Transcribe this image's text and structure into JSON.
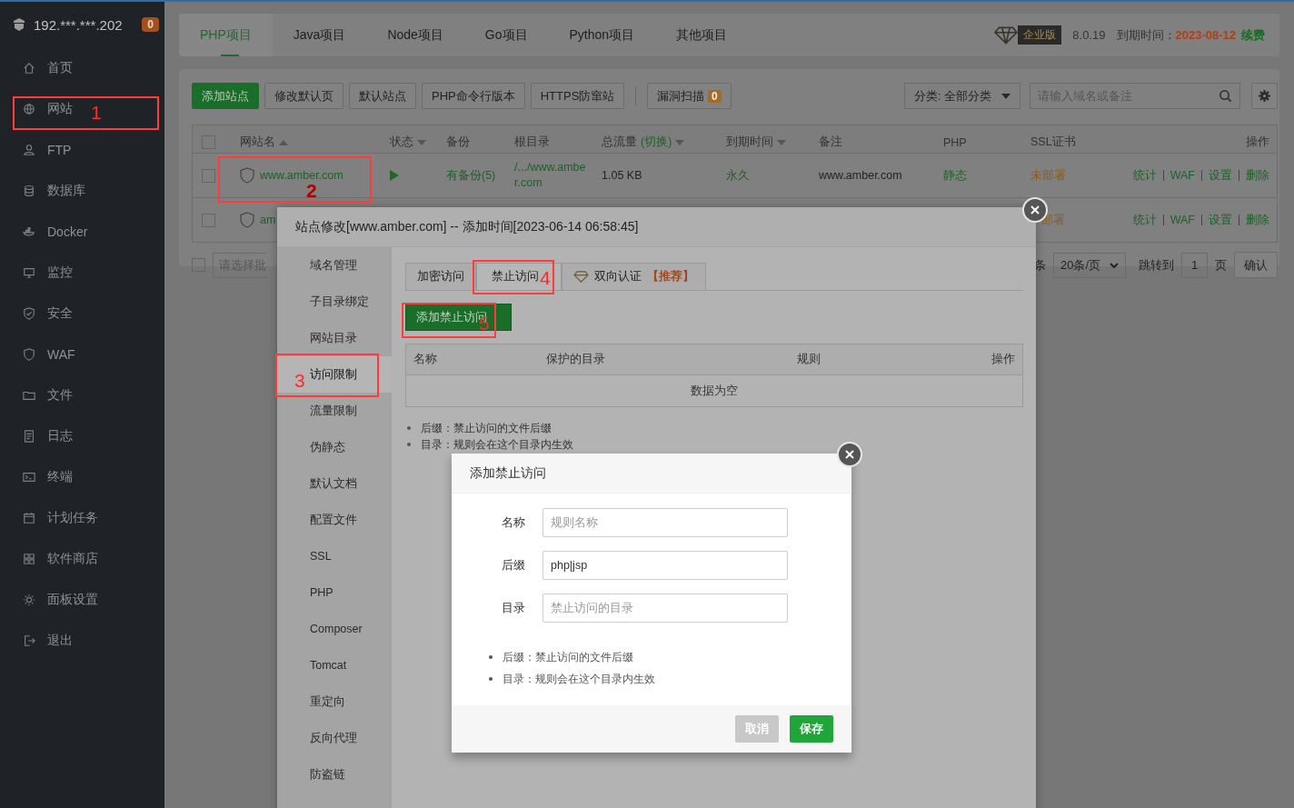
{
  "sidebar": {
    "host": "192.***.***.202",
    "badge": "0",
    "items": [
      {
        "label": "首页"
      },
      {
        "label": "网站"
      },
      {
        "label": "FTP"
      },
      {
        "label": "数据库"
      },
      {
        "label": "Docker"
      },
      {
        "label": "监控"
      },
      {
        "label": "安全"
      },
      {
        "label": "WAF"
      },
      {
        "label": "文件"
      },
      {
        "label": "日志"
      },
      {
        "label": "终端"
      },
      {
        "label": "计划任务"
      },
      {
        "label": "软件商店"
      },
      {
        "label": "面板设置"
      },
      {
        "label": "退出"
      }
    ]
  },
  "project_tabs": [
    {
      "label": "PHP项目",
      "selected": true
    },
    {
      "label": "Java项目",
      "selected": false
    },
    {
      "label": "Node项目",
      "selected": false
    },
    {
      "label": "Go项目",
      "selected": false
    },
    {
      "label": "Python项目",
      "selected": false
    },
    {
      "label": "其他项目",
      "selected": false
    }
  ],
  "edition": {
    "badge": "企业版",
    "version": "8.0.19",
    "expiry_label": "到期时间：",
    "expiry_date": "2023-08-12",
    "renew": "续费"
  },
  "toolbar": {
    "buttons": [
      {
        "label": "添加站点",
        "kind": "primary"
      },
      {
        "label": "修改默认页",
        "kind": "plain"
      },
      {
        "label": "默认站点",
        "kind": "plain"
      },
      {
        "label": "PHP命令行版本",
        "kind": "plain"
      },
      {
        "label": "HTTPS防窜站",
        "kind": "plain"
      }
    ],
    "scan": {
      "label": "漏洞扫描",
      "count": "0"
    },
    "category": "分类: 全部分类",
    "search_placeholder": "请输入域名或备注"
  },
  "table": {
    "header_checked": false,
    "columns": [
      {
        "label": "网站名",
        "kind": "sort-up"
      },
      {
        "label": "状态",
        "kind": "sort-down"
      },
      {
        "label": "备份"
      },
      {
        "label": "根目录"
      },
      {
        "label": "总流量",
        "extra": "(切换)",
        "kind": "sort-down"
      },
      {
        "label": "到期时间",
        "kind": "sort-down"
      },
      {
        "label": "备注"
      },
      {
        "label": "PHP"
      },
      {
        "label": "SSL证书"
      },
      {
        "label": "操作"
      }
    ],
    "rows": [
      {
        "checked": false,
        "name": "www.amber.com",
        "running": true,
        "backup": "有备份(5)",
        "root": "/.../www.amber.com",
        "traffic": "1.05 KB",
        "expiry": "永久",
        "remark": "www.amber.com",
        "php": "静态",
        "ssl": "未部署",
        "actions": [
          "统计",
          "WAF",
          "设置",
          "删除"
        ]
      },
      {
        "checked": false,
        "name": "am",
        "ssl": "部署",
        "actions": [
          "统计",
          "WAF",
          "设置",
          "删除"
        ]
      }
    ]
  },
  "footer": {
    "checked": false,
    "batch_placeholder": "请选择批",
    "count_fragment": "条",
    "page_size": "20条/页",
    "jump_label": "跳转到",
    "page": "1",
    "page_unit": "页",
    "confirm": "确认"
  },
  "site_dialog": {
    "title": "站点修改[www.amber.com] -- 添加时间[2023-06-14 06:58:45]",
    "nav": [
      {
        "label": "域名管理",
        "selected": false
      },
      {
        "label": "子目录绑定",
        "selected": false
      },
      {
        "label": "网站目录",
        "selected": false
      },
      {
        "label": "访问限制",
        "selected": true
      },
      {
        "label": "流量限制",
        "selected": false
      },
      {
        "label": "伪静态",
        "selected": false
      },
      {
        "label": "默认文档",
        "selected": false
      },
      {
        "label": "配置文件",
        "selected": false
      },
      {
        "label": "SSL",
        "selected": false
      },
      {
        "label": "PHP",
        "selected": false
      },
      {
        "label": "Composer",
        "selected": false
      },
      {
        "label": "Tomcat",
        "selected": false
      },
      {
        "label": "重定向",
        "selected": false
      },
      {
        "label": "反向代理",
        "selected": false
      },
      {
        "label": "防盗链",
        "selected": false
      }
    ],
    "tabs": [
      {
        "label": "加密访问",
        "selected": false
      },
      {
        "label": "禁止访问",
        "selected": true
      },
      {
        "label": "双向认证",
        "tag": "【推荐】",
        "selected": false
      }
    ],
    "add_button": "添加禁止访问",
    "columns": [
      "名称",
      "保护的目录",
      "规则",
      "操作"
    ],
    "empty": "数据为空",
    "hints": [
      "后缀：禁止访问的文件后缀",
      "目录：规则会在这个目录内生效"
    ]
  },
  "add_dialog": {
    "title": "添加禁止访问",
    "fields": [
      {
        "label": "名称",
        "placeholder": "规则名称"
      },
      {
        "label": "后缀",
        "value": "php|jsp"
      },
      {
        "label": "目录",
        "placeholder": "禁止访问的目录"
      }
    ],
    "hints": [
      "后缀：禁止访问的文件后缀",
      "目录：规则会在这个目录内生效"
    ],
    "buttons": [
      {
        "label": "取消",
        "kind": "cancel"
      },
      {
        "label": "保存",
        "kind": "primary"
      }
    ]
  },
  "annotations": [
    {
      "number": "1"
    },
    {
      "number": "2"
    },
    {
      "number": "3"
    },
    {
      "number": "4"
    },
    {
      "number": "5"
    }
  ]
}
